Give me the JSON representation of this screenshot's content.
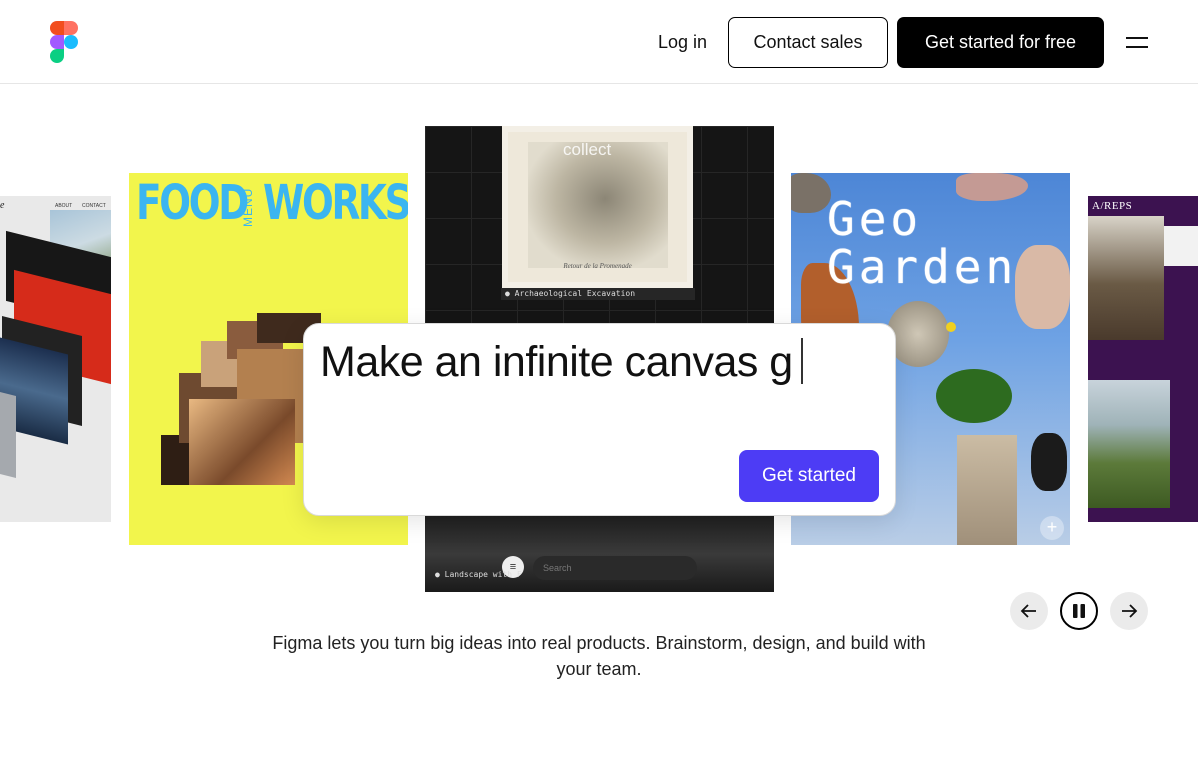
{
  "colors": {
    "accent": "#4d3cf5",
    "nav_dark": "#000000",
    "food_bg": "#f2f54c",
    "food_text": "#3bb5f0",
    "reps_bg": "#3c1250"
  },
  "nav": {
    "logo": "figma-logo-icon",
    "login": "Log in",
    "contact_sales": "Contact sales",
    "get_started_free": "Get started for free",
    "menu_icon": "hamburger-icon"
  },
  "cards": {
    "left": {
      "about": "ABOUT",
      "contact": "CONTACT",
      "letter": "e"
    },
    "food": {
      "title_left": "FOOD",
      "title_right": "WORKS",
      "menu": "MENU"
    },
    "dark": {
      "collect": "collect",
      "caption": "Retour de la Promenade",
      "label_top": "● Archaeological Excavation",
      "label_bottom": "● Landscape with F",
      "search_placeholder": "Search"
    },
    "geo": {
      "line1": "Geo",
      "line2": "Garden",
      "plus": "+"
    },
    "reps": {
      "label": "A/REPS"
    }
  },
  "prompt": {
    "text": "Make an infinite canvas g",
    "button": "Get started"
  },
  "carousel": {
    "prev_icon": "arrow-left-icon",
    "pause_icon": "pause-icon",
    "next_icon": "arrow-right-icon"
  },
  "tagline": "Figma lets you turn big ideas into real products. Brainstorm, design, and build with your team."
}
